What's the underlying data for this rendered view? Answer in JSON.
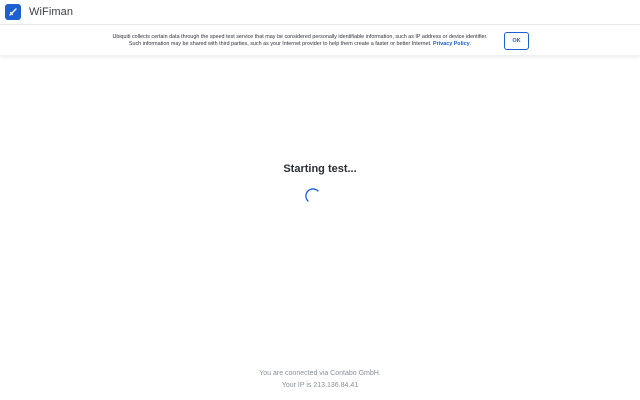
{
  "header": {
    "app_title": "WiFiman",
    "logo_icon": "wifiman-logo-icon"
  },
  "privacy_banner": {
    "text_line1": "Ubiquiti collects certain data through the speed test service that may be considered personally identifiable information, such as IP address or device identifier.",
    "text_line2": "Such information may be shared with third parties, such as your Internet provider to help them create a faster or better Internet.",
    "privacy_link_label": "Privacy Policy",
    "ok_label": "OK"
  },
  "main": {
    "status_title": "Starting test...",
    "spinner_icon": "loading-spinner-icon"
  },
  "footer": {
    "connected_text": "You are connected via Contabo GmbH.",
    "ip_text": "Your IP is 213.136.84.41"
  },
  "colors": {
    "accent": "#1b5fd0",
    "text": "#2b2f36",
    "muted": "#8a9099"
  }
}
